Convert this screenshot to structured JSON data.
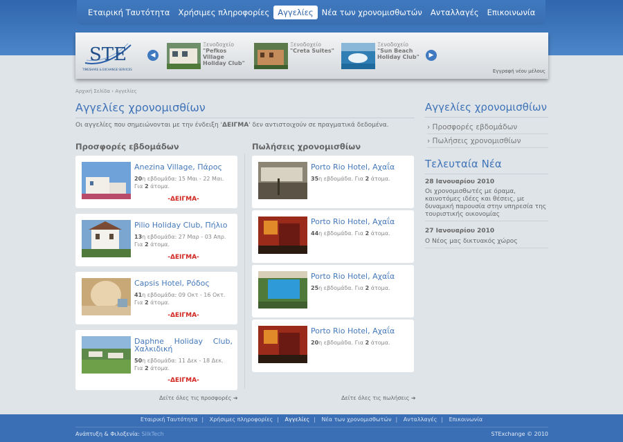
{
  "nav": {
    "items": [
      "Εταιρική Ταυτότητα",
      "Χρήσιμες πληροφορίες",
      "Αγγελίες",
      "Νέα των χρονομισθωτών",
      "Ανταλλαγές",
      "Επικοινωνία"
    ],
    "active": "Αγγελίες"
  },
  "logo": {
    "text": "STE",
    "sub": "TIMESHARE & EXCHANGE SERVICES"
  },
  "slider": {
    "items": [
      {
        "label": "Ξενοδοχείο",
        "name": "\"Pefkos Village Holiday Club\""
      },
      {
        "label": "Ξενοδοχείο",
        "name": "\"Creta Suites\""
      },
      {
        "label": "Ξενοδοχείο",
        "name": "\"Sun Beach Holiday Club\""
      }
    ],
    "register": "Εγγραφή νέου μέλους",
    "prev_icon": "arrow-left-icon",
    "next_icon": "arrow-right-icon"
  },
  "breadcrumb": {
    "home": "Αρχική Σελίδα",
    "sep": "›",
    "current": "Αγγελίες"
  },
  "page": {
    "title": "Αγγελίες χρονομισθίων",
    "intro_before": "Οι αγγελίες που σημειώνονται με την ένδειξη '",
    "intro_tag": "ΔΕΙΓΜΑ",
    "intro_after": "' δεν αντιστοιχούν σε πραγματικά δεδομένα."
  },
  "offers": {
    "title": "Προσφορές εβδομάδων",
    "more": "Δείτε όλες τις προσφορές",
    "items": [
      {
        "title": "Anezina Village, Πάρος",
        "num": "20",
        "week_text": "η εβδομάδα: 15 Μαι - 22 Μαι.",
        "persons_prefix": "Για ",
        "persons": "2",
        "persons_suffix": " άτομα.",
        "sample": "-ΔΕΙΓΜΑ-"
      },
      {
        "title": "Pilio Holiday Club, Πήλιο",
        "num": "13",
        "week_text": "η εβδομάδα: 27 Μαρ - 03 Απρ.",
        "persons_prefix": "Για ",
        "persons": "2",
        "persons_suffix": " άτομα.",
        "sample": "-ΔΕΙΓΜΑ-"
      },
      {
        "title": "Capsis Hotel, Ρόδος",
        "num": "41",
        "week_text": "η εβδομάδα: 09 Οκτ - 16 Οκτ.",
        "persons_prefix": "Για ",
        "persons": "2",
        "persons_suffix": " άτομα.",
        "sample": "-ΔΕΙΓΜΑ-"
      },
      {
        "title": "Daphne Holiday Club, Χαλκιδική",
        "num": "50",
        "week_text": "η εβδομάδα: 11 Δεκ - 18 Δεκ.",
        "persons_prefix": "Για ",
        "persons": "2",
        "persons_suffix": " άτομα.",
        "sample": "-ΔΕΙΓΜΑ-"
      }
    ]
  },
  "sales": {
    "title": "Πωλήσεις χρονομισθίων",
    "more": "Δείτε όλες τις πωλήσεις",
    "items": [
      {
        "title": "Porto Rio Hotel, Αχαΐα",
        "num": "35",
        "week_text": "η εβδομάδα. Για ",
        "persons": "2",
        "persons_suffix": " άτομα."
      },
      {
        "title": "Porto Rio Hotel, Αχαΐα",
        "num": "44",
        "week_text": "η εβδομάδα. Για ",
        "persons": "2",
        "persons_suffix": " άτομα."
      },
      {
        "title": "Porto Rio Hotel, Αχαΐα",
        "num": "25",
        "week_text": "η εβδομάδα. Για ",
        "persons": "2",
        "persons_suffix": " άτομα."
      },
      {
        "title": "Porto Rio Hotel, Αχαΐα",
        "num": "20",
        "week_text": "η εβδομάδα. Για ",
        "persons": "2",
        "persons_suffix": " άτομα."
      }
    ]
  },
  "sidebar": {
    "title": "Αγγελίες χρονομισθίων",
    "links": [
      "Προσφορές εβδομάδων",
      "Πωλήσεις χρονομισθίων"
    ],
    "news_title": "Τελευταία Νέα",
    "news": [
      {
        "date": "28 Ιανουαρίου 2010",
        "text": "Οι χρονομισθωτές με όραμα, καινοτόμες ιδέες και θέσεις, με δυναμική παρουσία στην υπηρεσία της τουριστικής οικονομίας"
      },
      {
        "date": "27 Ιανουαρίου 2010",
        "text": "Ο Νέος μας δικτυακός χώρος"
      }
    ]
  },
  "footer": {
    "links": [
      "Εταιρική Ταυτότητα",
      "Χρήσιμες πληροφορίες",
      "Αγγελίες",
      "Νέα των χρονομισθωτών",
      "Ανταλλαγές",
      "Επικοινωνία"
    ],
    "active": "Αγγελίες",
    "dev_label": "Ανάπτυξη & Φιλοξενία:",
    "dev_name": "SilkTech",
    "copyright": "STExchange © 2010"
  },
  "colors": {
    "accent": "#3f73b8",
    "sample": "#d2251f",
    "footer": "#3a6eb5"
  }
}
